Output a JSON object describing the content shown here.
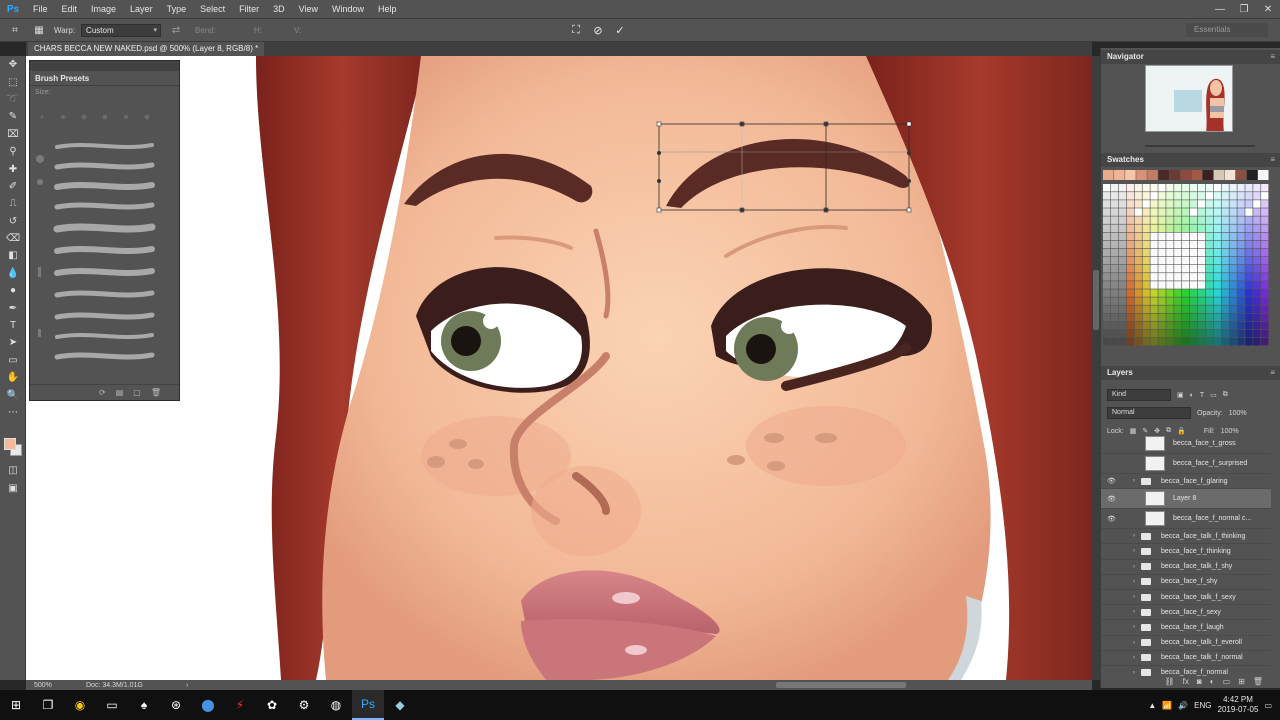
{
  "app": {
    "logo": "Ps",
    "menu": [
      "File",
      "Edit",
      "Image",
      "Layer",
      "Type",
      "Select",
      "Filter",
      "3D",
      "View",
      "Window",
      "Help"
    ],
    "window_controls": [
      "—",
      "❐",
      "✕"
    ]
  },
  "options_bar": {
    "warp_label": "Warp:",
    "warp_value": "Custom",
    "bend_label": "Bend:",
    "dim_h": "H:",
    "dim_v": "V:",
    "cancel_icon": "⊘",
    "commit_icon": "✓",
    "workspace": "Essentials"
  },
  "document": {
    "tab_title": "CHARS BECCA NEW NAKED.psd @ 500% (Layer 8, RGB/8) *",
    "zoom": "500%",
    "doc_size": "Doc: 34.3M/1.01G"
  },
  "brush_presets": {
    "title": "Brush Presets",
    "size_label": "Size:"
  },
  "navigator": {
    "title": "Navigator"
  },
  "swatches": {
    "title": "Swatches",
    "top_row": [
      "#e8a98c",
      "#f0b394",
      "#f6c4a6",
      "#d89377",
      "#c27c65",
      "#4a2a25",
      "#6b3a32",
      "#8e4a3d",
      "#a35a45",
      "#3b2220",
      "#d7c8b6",
      "#f1e3d4",
      "#8a4f3e",
      "#222222",
      "#f7f7f7"
    ]
  },
  "layers": {
    "title": "Layers",
    "kind_label": "Kind",
    "blend_mode": "Normal",
    "opacity_label": "Opacity:",
    "opacity_value": "100%",
    "lock_label": "Lock:",
    "fill_label": "Fill:",
    "fill_value": "100%",
    "items": [
      {
        "name": "becca_face_t_gross",
        "type": "thumb",
        "visible": false,
        "selected": false
      },
      {
        "name": "becca_face_f_surprised",
        "type": "thumb",
        "visible": false,
        "selected": false
      },
      {
        "name": "becca_face_f_glaring",
        "type": "folder",
        "visible": true,
        "selected": false
      },
      {
        "name": "Layer 8",
        "type": "thumb",
        "visible": true,
        "selected": true
      },
      {
        "name": "becca_face_f_normal c...",
        "type": "thumb",
        "visible": true,
        "selected": false
      },
      {
        "name": "becca_face_talk_f_thinking",
        "type": "folder",
        "visible": false,
        "selected": false
      },
      {
        "name": "becca_face_f_thinking",
        "type": "folder",
        "visible": false,
        "selected": false
      },
      {
        "name": "becca_face_talk_f_shy",
        "type": "folder",
        "visible": false,
        "selected": false
      },
      {
        "name": "becca_face_f_shy",
        "type": "folder",
        "visible": false,
        "selected": false
      },
      {
        "name": "becca_face_talk_f_sexy",
        "type": "folder",
        "visible": false,
        "selected": false
      },
      {
        "name": "becca_face_f_sexy",
        "type": "folder",
        "visible": false,
        "selected": false
      },
      {
        "name": "becca_face_f_laugh",
        "type": "folder",
        "visible": false,
        "selected": false
      },
      {
        "name": "becca_face_talk_f_everoll",
        "type": "folder",
        "visible": false,
        "selected": false
      },
      {
        "name": "becca_face_talk_f_normal",
        "type": "folder",
        "visible": false,
        "selected": false
      },
      {
        "name": "becca_face_f_normal",
        "type": "folder",
        "visible": false,
        "selected": false
      }
    ]
  },
  "taskbar": {
    "lang": "ENG",
    "time": "4:42 PM",
    "date": "2019-07-05"
  },
  "colors": {
    "hair": "#8b2a22",
    "skin": "#f6c4a4",
    "brow": "#5a2a25",
    "iris": "#6f7a58",
    "lips": "#c9757a"
  }
}
